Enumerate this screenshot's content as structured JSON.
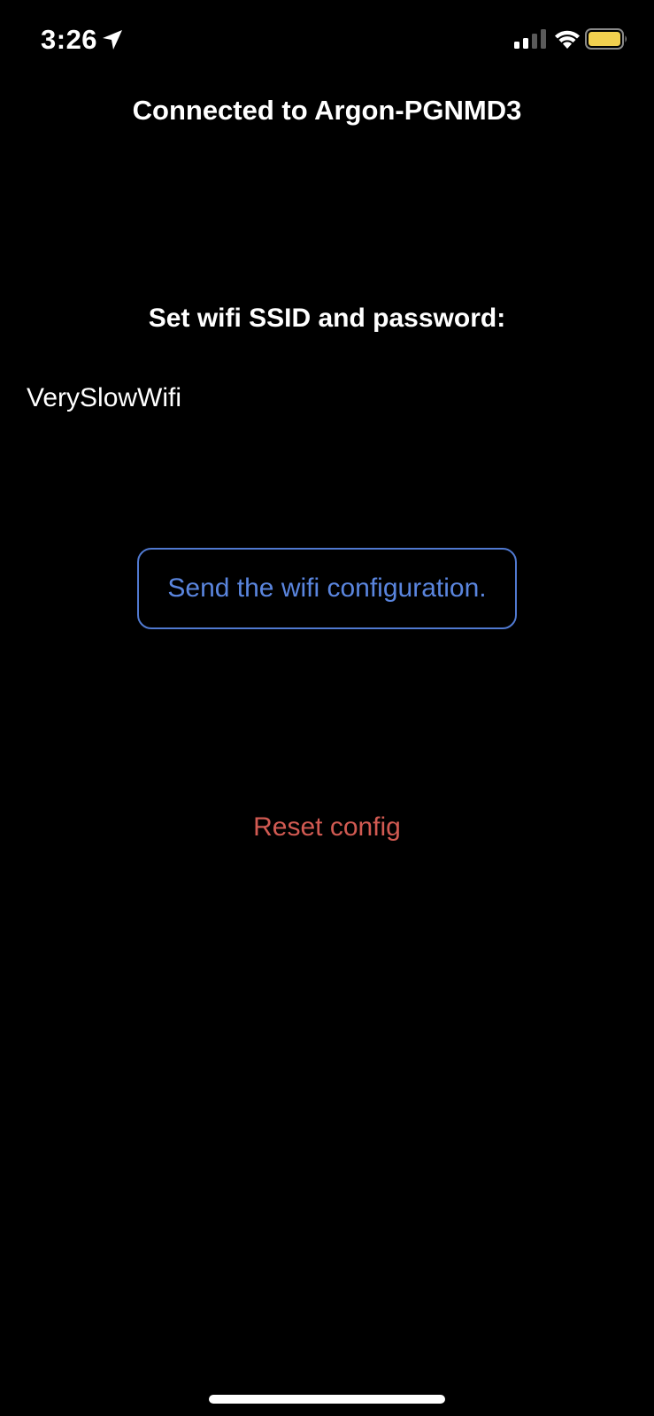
{
  "status_bar": {
    "time": "3:26",
    "location_icon": "location-arrow-icon",
    "signal_icon": "cellular-signal-icon",
    "wifi_icon": "wifi-icon",
    "battery_icon": "battery-icon",
    "battery_color": "#f2d04f"
  },
  "header": {
    "title": "Connected to Argon-PGNMD3"
  },
  "wifi_form": {
    "label": "Set wifi SSID and password:",
    "ssid_value": "VerySlowWifi",
    "password_value": "",
    "send_label": "Send the wifi configuration."
  },
  "reset": {
    "label": "Reset config"
  },
  "colors": {
    "background": "#000000",
    "accent": "#5a85de",
    "destructive": "#d15a52"
  }
}
